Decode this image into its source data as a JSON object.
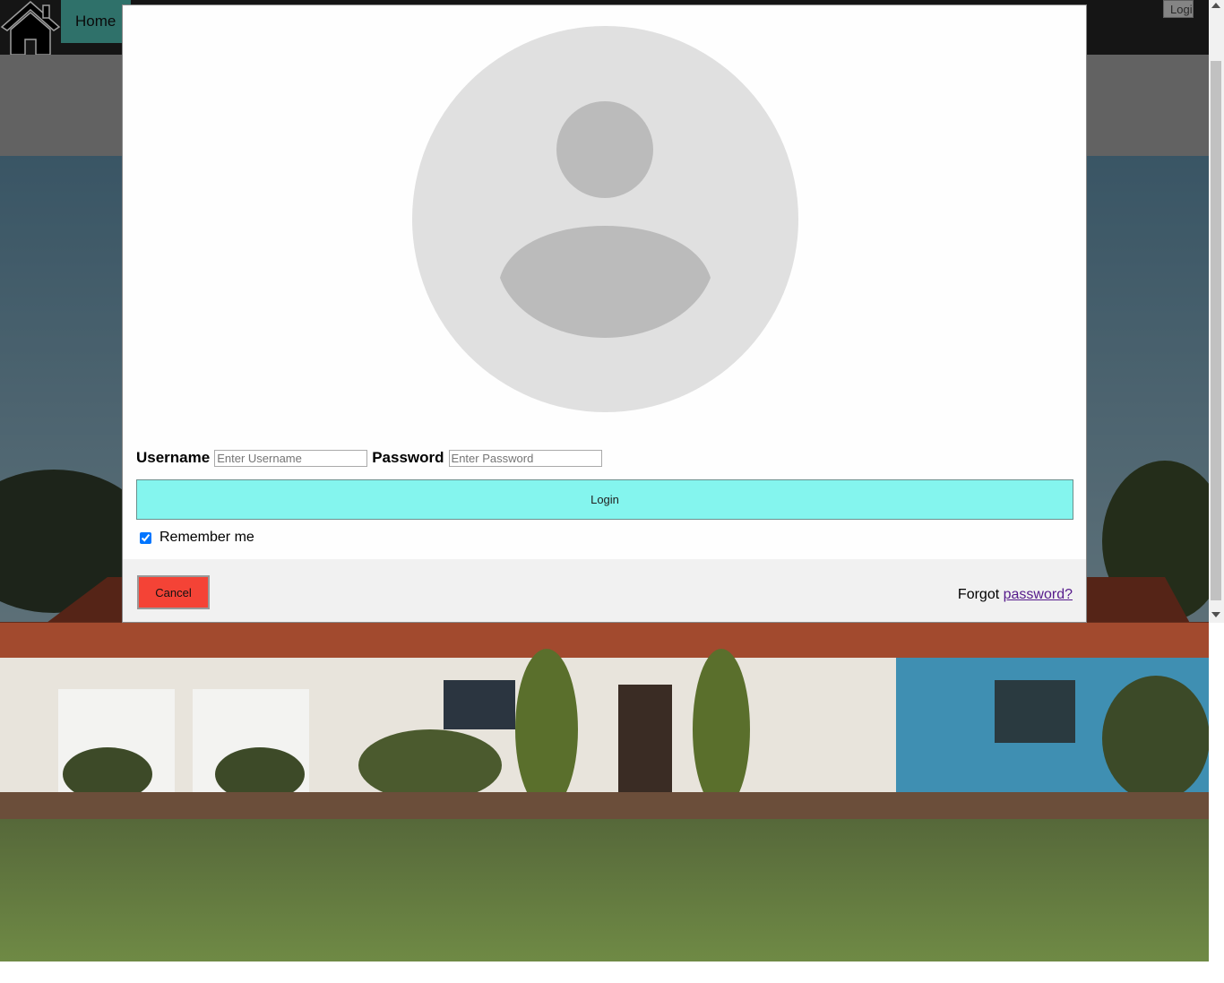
{
  "nav": {
    "home_label": "Home",
    "login_label": "Login"
  },
  "modal": {
    "username_label": "Username",
    "username_placeholder": "Enter Username",
    "password_label": "Password",
    "password_placeholder": "Enter Password",
    "submit_label": "Login",
    "remember_label": "Remember me",
    "remember_checked": true,
    "cancel_label": "Cancel",
    "forgot_prefix": "Forgot",
    "forgot_link": "password?"
  },
  "colors": {
    "navbar": "#222222",
    "home_active": "#4db6ac",
    "submit_button": "#84f5ee",
    "cancel_button": "#f44336",
    "link": "#551a8b"
  },
  "icons": {
    "home": "home-icon",
    "avatar": "avatar-icon"
  }
}
